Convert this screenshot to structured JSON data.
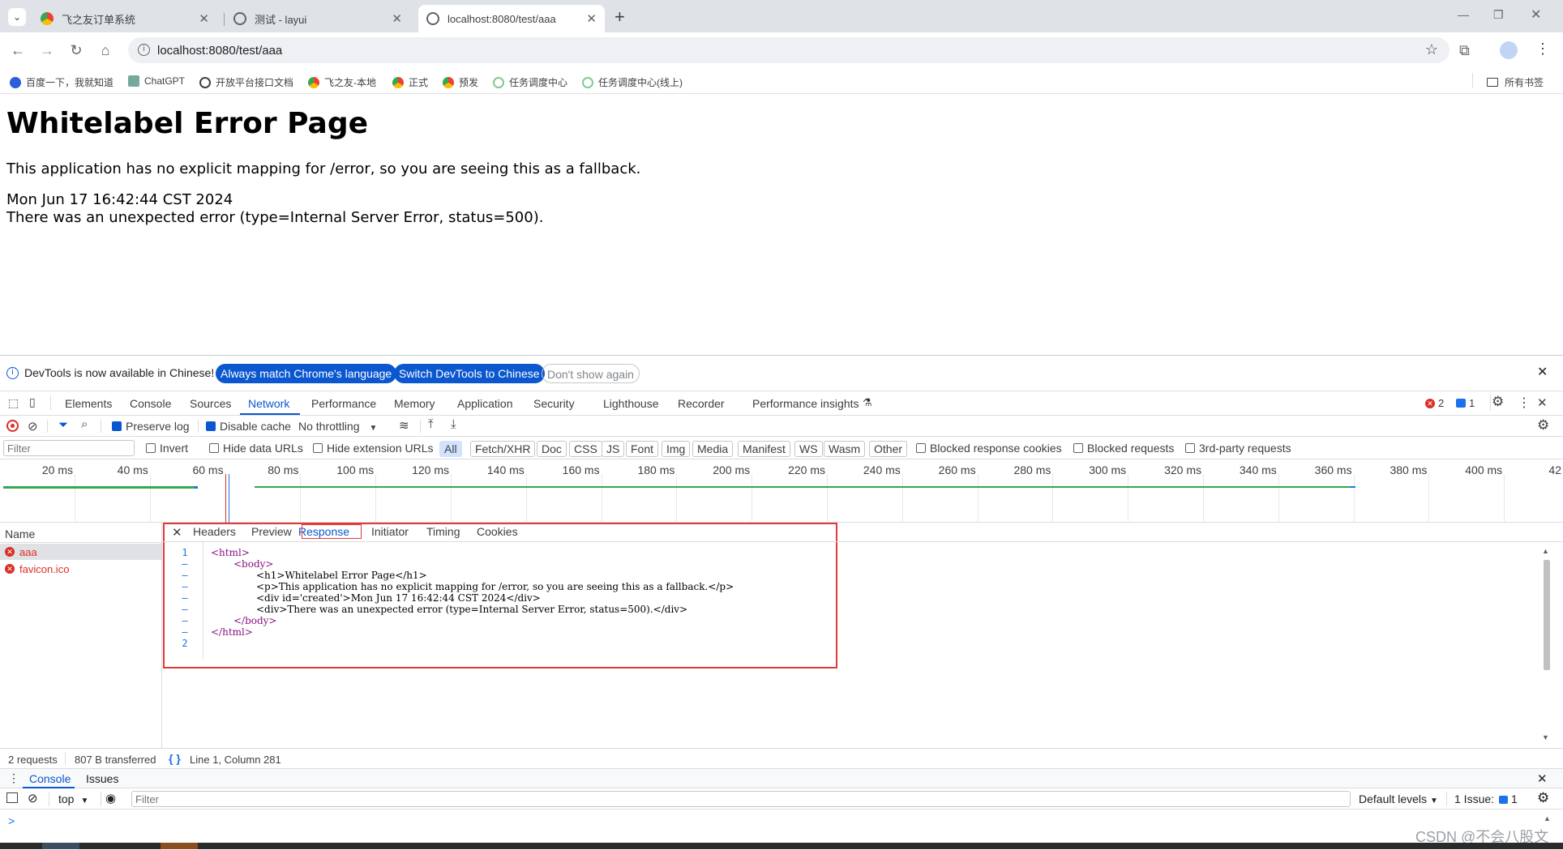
{
  "browser": {
    "tabs": [
      {
        "title": "飞之友订单系统",
        "icon_color": "#f4b400"
      },
      {
        "title": "测试 - layui",
        "icon_color": "#5f6368"
      },
      {
        "title": "localhost:8080/test/aaa",
        "icon_color": "#5f6368"
      }
    ],
    "new_tab": "+",
    "url": "localhost:8080/test/aaa",
    "bookmarks": [
      "百度一下，我就知道",
      "ChatGPT",
      "开放平台接口文档",
      "飞之友-本地",
      "正式",
      "预发",
      "任务调度中心",
      "任务调度中心(线上)"
    ],
    "all_bookmarks": "所有书签"
  },
  "page": {
    "title": "Whitelabel Error Page",
    "message": "This application has no explicit mapping for /error, so you are seeing this as a fallback.",
    "timestamp": "Mon Jun 17 16:42:44 CST 2024",
    "error": "There was an unexpected error (type=Internal Server Error, status=500)."
  },
  "devtools": {
    "infobar": {
      "text": "DevTools is now available in Chinese!",
      "btn_match": "Always match Chrome's language",
      "btn_switch": "Switch DevTools to Chinese",
      "btn_dismiss": "Don't show again"
    },
    "tabs": [
      "Elements",
      "Console",
      "Sources",
      "Network",
      "Performance",
      "Memory",
      "Application",
      "Security",
      "Lighthouse",
      "Recorder",
      "Performance insights"
    ],
    "active_tab": "Network",
    "errors_count": "2",
    "messages_count": "1",
    "network": {
      "preserve_log": "Preserve log",
      "disable_cache": "Disable cache",
      "throttling": "No throttling",
      "filter_placeholder": "Filter",
      "invert": "Invert",
      "hide_data_urls": "Hide data URLs",
      "hide_ext_urls": "Hide extension URLs",
      "types": [
        "All",
        "Fetch/XHR",
        "Doc",
        "CSS",
        "JS",
        "Font",
        "Img",
        "Media",
        "Manifest",
        "WS",
        "Wasm",
        "Other"
      ],
      "blocked_cookies": "Blocked response cookies",
      "blocked_requests": "Blocked requests",
      "third_party": "3rd-party requests",
      "timeline_ticks": [
        "20 ms",
        "40 ms",
        "60 ms",
        "80 ms",
        "100 ms",
        "120 ms",
        "140 ms",
        "160 ms",
        "180 ms",
        "200 ms",
        "220 ms",
        "240 ms",
        "260 ms",
        "280 ms",
        "300 ms",
        "320 ms",
        "340 ms",
        "360 ms",
        "380 ms",
        "400 ms",
        "42"
      ],
      "name_header": "Name",
      "requests": [
        "aaa",
        "favicon.ico"
      ],
      "detail_tabs": [
        "Headers",
        "Preview",
        "Response",
        "Initiator",
        "Timing",
        "Cookies"
      ],
      "active_detail_tab": "Response",
      "line_numbers": [
        "1",
        "–",
        "–",
        "–",
        "–",
        "–",
        "–",
        "–",
        "2"
      ],
      "response_lines": [
        "<html>",
        "<body>",
        "<h1>Whitelabel Error Page</h1>",
        "<p>This application has no explicit mapping for /error, so you are seeing this as a fallback.</p>",
        "<div id='created'>Mon Jun 17 16:42:44 CST 2024</div>",
        "<div>There was an unexpected error (type=Internal Server Error, status=500).</div>",
        "</body>",
        "</html>"
      ],
      "status_requests": "2 requests",
      "status_transferred": "807 B transferred",
      "cursor_pos": "Line 1, Column 281"
    },
    "drawer": {
      "tabs": [
        "Console",
        "Issues"
      ],
      "context": "top",
      "filter_placeholder": "Filter",
      "levels": "Default levels",
      "issues": "1 Issue:",
      "issues_count": "1",
      "prompt": ">"
    }
  },
  "watermark": "CSDN @不会八股文"
}
